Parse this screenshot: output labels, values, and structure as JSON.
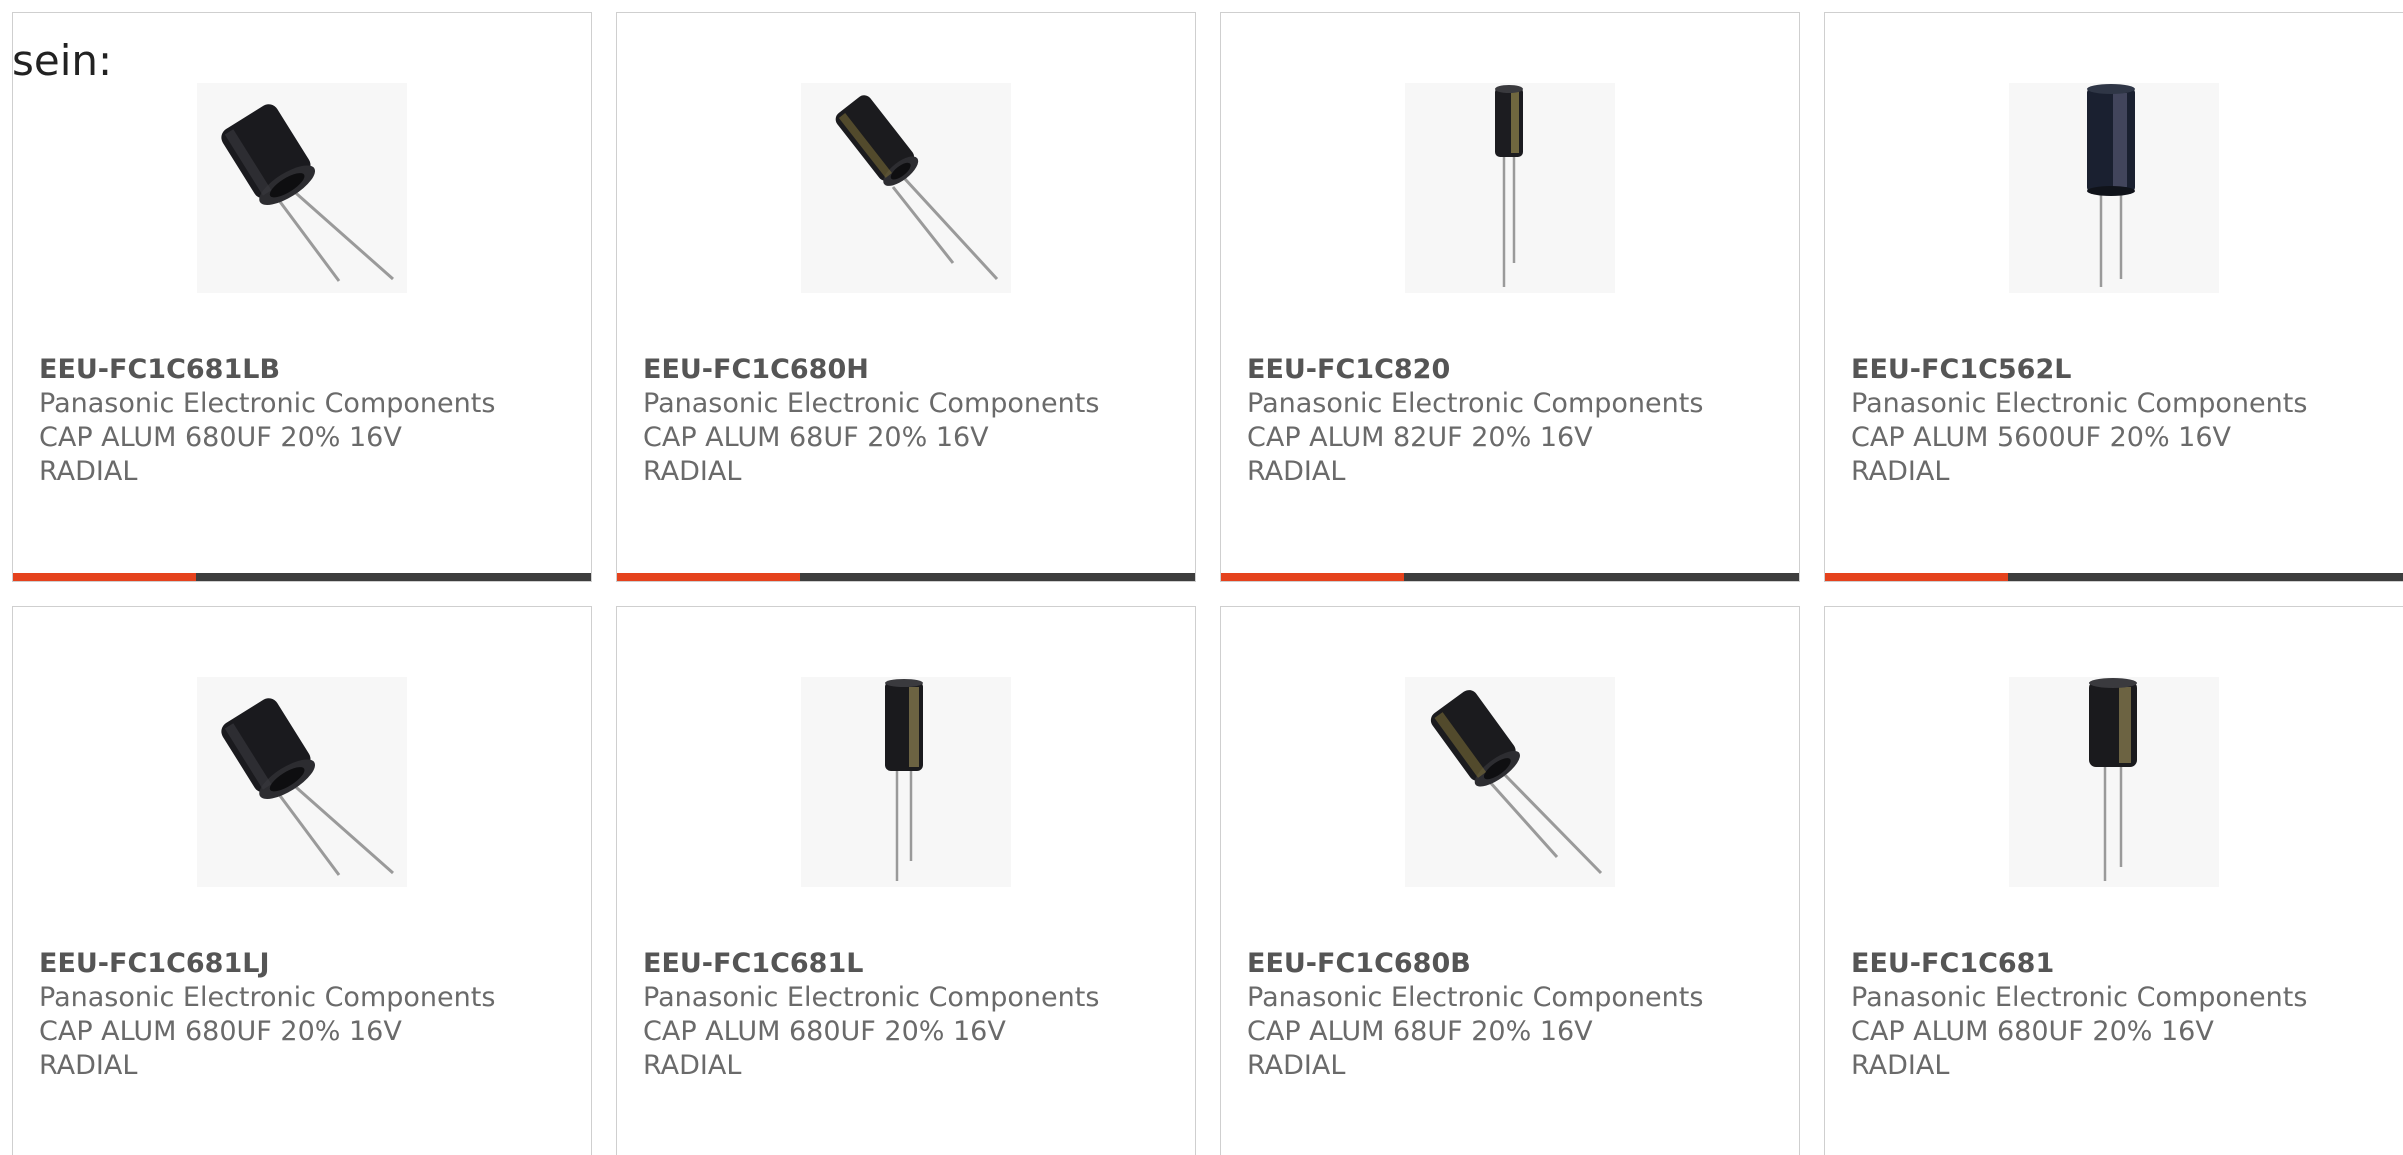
{
  "intro_text": "sein:",
  "colors": {
    "accent": "#e5421d",
    "bar": "#3d3d3d",
    "border": "#cfcfcf",
    "text": "#6a6a6a"
  },
  "products": [
    {
      "part_number": "EEU-FC1C681LB",
      "manufacturer": "Panasonic Electronic Components",
      "desc_line1": "CAP ALUM 680UF 20% 16V",
      "desc_line2": "RADIAL",
      "image": "capacitor-angled-icon"
    },
    {
      "part_number": "EEU-FC1C680H",
      "manufacturer": "Panasonic Electronic Components",
      "desc_line1": "CAP ALUM 68UF 20% 16V",
      "desc_line2": "RADIAL",
      "image": "capacitor-angled-icon"
    },
    {
      "part_number": "EEU-FC1C820",
      "manufacturer": "Panasonic Electronic Components",
      "desc_line1": "CAP ALUM 82UF 20% 16V",
      "desc_line2": "RADIAL",
      "image": "capacitor-upright-icon"
    },
    {
      "part_number": "EEU-FC1C562L",
      "manufacturer": "Panasonic Electronic Components",
      "desc_line1": "CAP ALUM 5600UF 20% 16V",
      "desc_line2": "RADIAL",
      "image": "capacitor-upright-icon"
    },
    {
      "part_number": "EEU-FC1C681LJ",
      "manufacturer": "Panasonic Electronic Components",
      "desc_line1": "CAP ALUM 680UF 20% 16V",
      "desc_line2": "RADIAL",
      "image": "capacitor-angled-icon"
    },
    {
      "part_number": "EEU-FC1C681L",
      "manufacturer": "Panasonic Electronic Components",
      "desc_line1": "CAP ALUM 680UF 20% 16V",
      "desc_line2": "RADIAL",
      "image": "capacitor-upright-icon"
    },
    {
      "part_number": "EEU-FC1C680B",
      "manufacturer": "Panasonic Electronic Components",
      "desc_line1": "CAP ALUM 68UF 20% 16V",
      "desc_line2": "RADIAL",
      "image": "capacitor-angled-icon"
    },
    {
      "part_number": "EEU-FC1C681",
      "manufacturer": "Panasonic Electronic Components",
      "desc_line1": "CAP ALUM 680UF 20% 16V",
      "desc_line2": "RADIAL",
      "image": "capacitor-upright-icon"
    }
  ]
}
